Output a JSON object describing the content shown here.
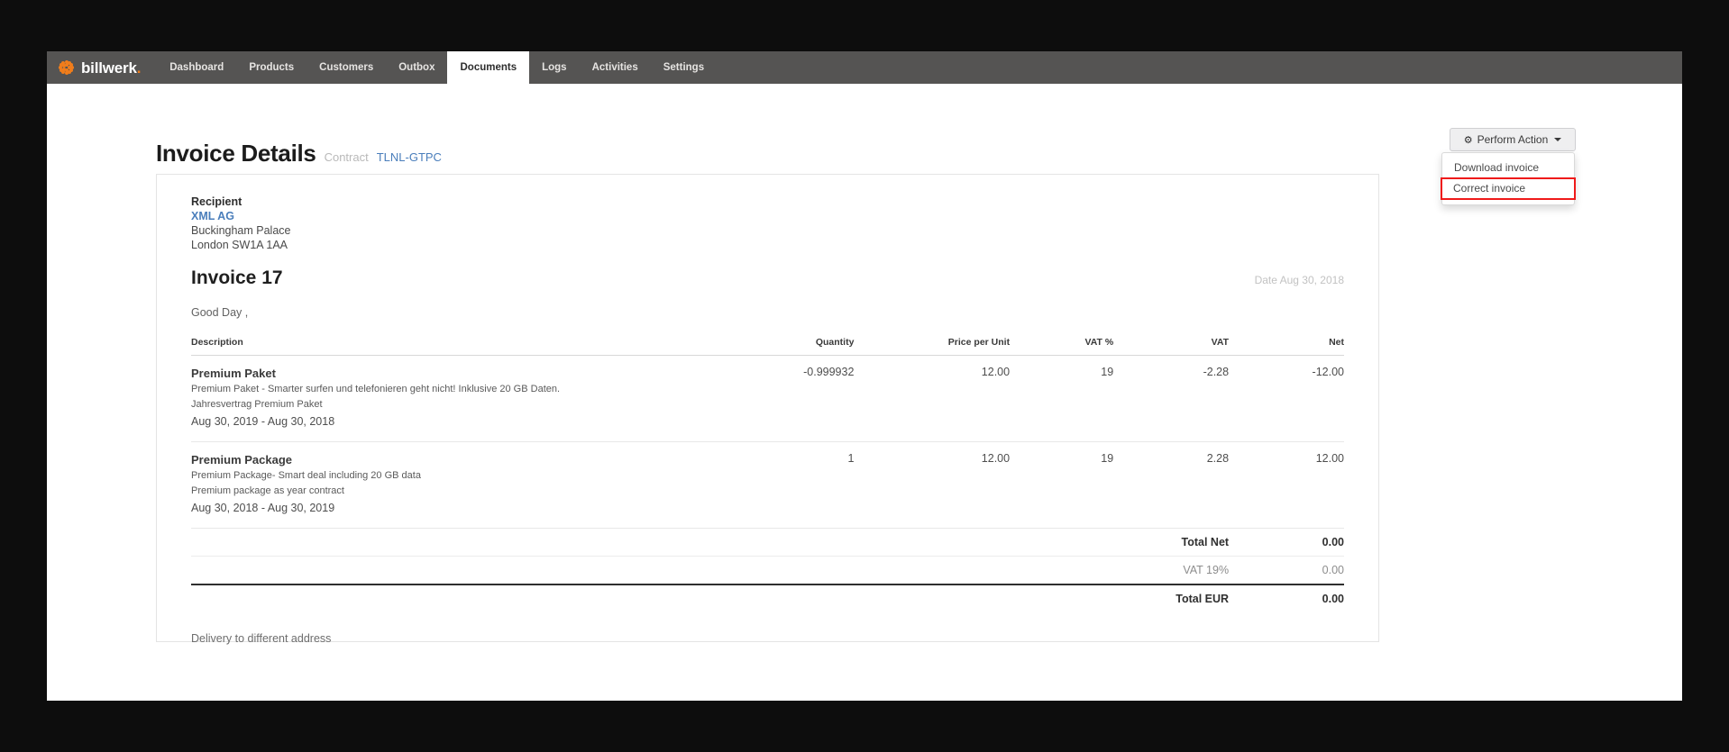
{
  "nav": {
    "brand": {
      "name": "billwerk",
      "dot": ".",
      "icon": "billwerk-dots-logo"
    },
    "items": [
      {
        "label": "Dashboard",
        "active": false
      },
      {
        "label": "Products",
        "active": false
      },
      {
        "label": "Customers",
        "active": false
      },
      {
        "label": "Outbox",
        "active": false
      },
      {
        "label": "Documents",
        "active": true
      },
      {
        "label": "Logs",
        "active": false
      },
      {
        "label": "Activities",
        "active": false
      },
      {
        "label": "Settings",
        "active": false
      }
    ]
  },
  "header": {
    "title": "Invoice Details",
    "contract_label": "Contract",
    "contract_id": "TLNL-GTPC"
  },
  "perform_action": {
    "label": "Perform Action",
    "gear_icon": "gear-icon",
    "caret_icon": "caret-down-icon",
    "menu": [
      {
        "label": "Download invoice",
        "highlighted": false
      },
      {
        "label": "Correct invoice",
        "highlighted": true
      }
    ],
    "highlight_color": "#ef1a1a"
  },
  "invoice": {
    "recipient_label": "Recipient",
    "recipient_name": "XML AG",
    "recipient_address_1": "Buckingham Palace",
    "recipient_address_2": "London SW1A 1AA",
    "number_title": "Invoice 17",
    "date_label": "Date Aug 30, 2018",
    "greeting": "Good Day ,",
    "delivery_note": "Delivery to different address",
    "columns": [
      "Description",
      "Quantity",
      "Price per Unit",
      "VAT %",
      "VAT",
      "Net"
    ],
    "rows": [
      {
        "name": "Premium Paket",
        "description": "Premium Paket - Smarter surfen und telefonieren geht nicht! Inklusive 20 GB Daten.",
        "plan": "Jahresvertrag Premium Paket",
        "period": "Aug 30, 2019 - Aug 30, 2018",
        "quantity": "-0.999932",
        "price_per_unit": "12.00",
        "vat_percent": "19",
        "vat": "-2.28",
        "net": "-12.00"
      },
      {
        "name": "Premium Package",
        "description": "Premium Package- Smart deal including 20 GB data",
        "plan": "Premium package as year contract",
        "period": "Aug 30, 2018 - Aug 30, 2019",
        "quantity": "1",
        "price_per_unit": "12.00",
        "vat_percent": "19",
        "vat": "2.28",
        "net": "12.00"
      }
    ],
    "totals": [
      {
        "label": "Total Net",
        "value": "0.00"
      },
      {
        "label": "VAT 19%",
        "value": "0.00"
      },
      {
        "label": "Total EUR",
        "value": "0.00"
      }
    ]
  }
}
